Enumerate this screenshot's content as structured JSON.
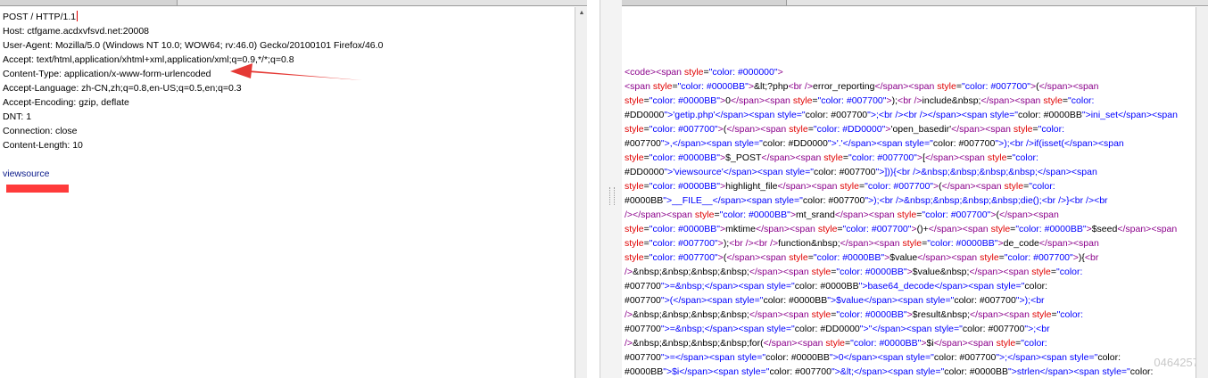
{
  "request": {
    "lines": [
      "POST / HTTP/1.1",
      "Host: ctfgame.acdxvfsvd.net:20008",
      "User-Agent: Mozilla/5.0 (Windows NT 10.0; WOW64; rv:46.0) Gecko/20100101 Firefox/46.0",
      "Accept: text/html,application/xhtml+xml,application/xml;q=0.9,*/*;q=0.8",
      "Content-Type: application/x-www-form-urlencoded",
      "Accept-Language: zh-CN,zh;q=0.8,en-US;q=0.5,en;q=0.3",
      "Accept-Encoding: gzip, deflate",
      "DNT: 1",
      "Connection: close",
      "Content-Length: 10"
    ],
    "body": "viewsource"
  },
  "response": {
    "lines": [
      "<code><span style=\"color: #000000\">",
      "<span style=\"color: #0000BB\">&lt;?php<br />error_reporting</span><span style=\"color: #007700\">(</span><span",
      "style=\"color: #0000BB\">0</span><span style=\"color: #007700\">);<br />include&nbsp;</span><span style=\"color:",
      "#DD0000\">'getip.php'</span><span style=\"color: #007700\">;<br /><br /></span><span style=\"color: #0000BB\">ini_set</span><span",
      "style=\"color: #007700\">(</span><span style=\"color: #DD0000\">'open_basedir'</span><span style=\"color:",
      "#007700\">,</span><span style=\"color: #DD0000\">'.'</span><span style=\"color: #007700\">);<br />if(isset(</span><span",
      "style=\"color: #0000BB\">$_POST</span><span style=\"color: #007700\">[</span><span style=\"color:",
      "#DD0000\">'viewsource'</span><span style=\"color: #007700\">])){<br />&nbsp;&nbsp;&nbsp;&nbsp;</span><span",
      "style=\"color: #0000BB\">highlight_file</span><span style=\"color: #007700\">(</span><span style=\"color:",
      "#0000BB\">__FILE__</span><span style=\"color: #007700\">);<br />&nbsp;&nbsp;&nbsp;&nbsp;die();<br />}<br /><br",
      "/></span><span style=\"color: #0000BB\">mt_srand</span><span style=\"color: #007700\">(</span><span",
      "style=\"color: #0000BB\">mktime</span><span style=\"color: #007700\">()+</span><span style=\"color: #0000BB\">$seed</span><span",
      "style=\"color: #007700\">);<br /><br />function&nbsp;</span><span style=\"color: #0000BB\">de_code</span><span",
      "style=\"color: #007700\">(</span><span style=\"color: #0000BB\">$value</span><span style=\"color: #007700\">){<br",
      "/>&nbsp;&nbsp;&nbsp;&nbsp;</span><span style=\"color: #0000BB\">$value&nbsp;</span><span style=\"color:",
      "#007700\">=&nbsp;</span><span style=\"color: #0000BB\">base64_decode</span><span style=\"color:",
      "#007700\">(</span><span style=\"color: #0000BB\">$value</span><span style=\"color: #007700\">);<br",
      "/>&nbsp;&nbsp;&nbsp;&nbsp;</span><span style=\"color: #0000BB\">$result&nbsp;</span><span style=\"color:",
      "#007700\">=&nbsp;</span><span style=\"color: #DD0000\">''</span><span style=\"color: #007700\">;<br",
      "/>&nbsp;&nbsp;&nbsp;&nbsp;for(</span><span style=\"color: #0000BB\">$i</span><span style=\"color:",
      "#007700\">=</span><span style=\"color: #0000BB\">0</span><span style=\"color: #007700\">;</span><span style=\"color:",
      "#0000BB\">$i</span><span style=\"color: #007700\">&lt;</span><span style=\"color: #0000BB\">strlen</span><span style=\"color:"
    ]
  },
  "watermark": "0464257",
  "colors": {
    "tag": "#8b008b",
    "attr_name": "#e00000",
    "attr_value": "#0000ff",
    "body_param": "#0a1a8a",
    "annotation_arrow": "#e53935",
    "redaction": "#ff3b3b"
  }
}
